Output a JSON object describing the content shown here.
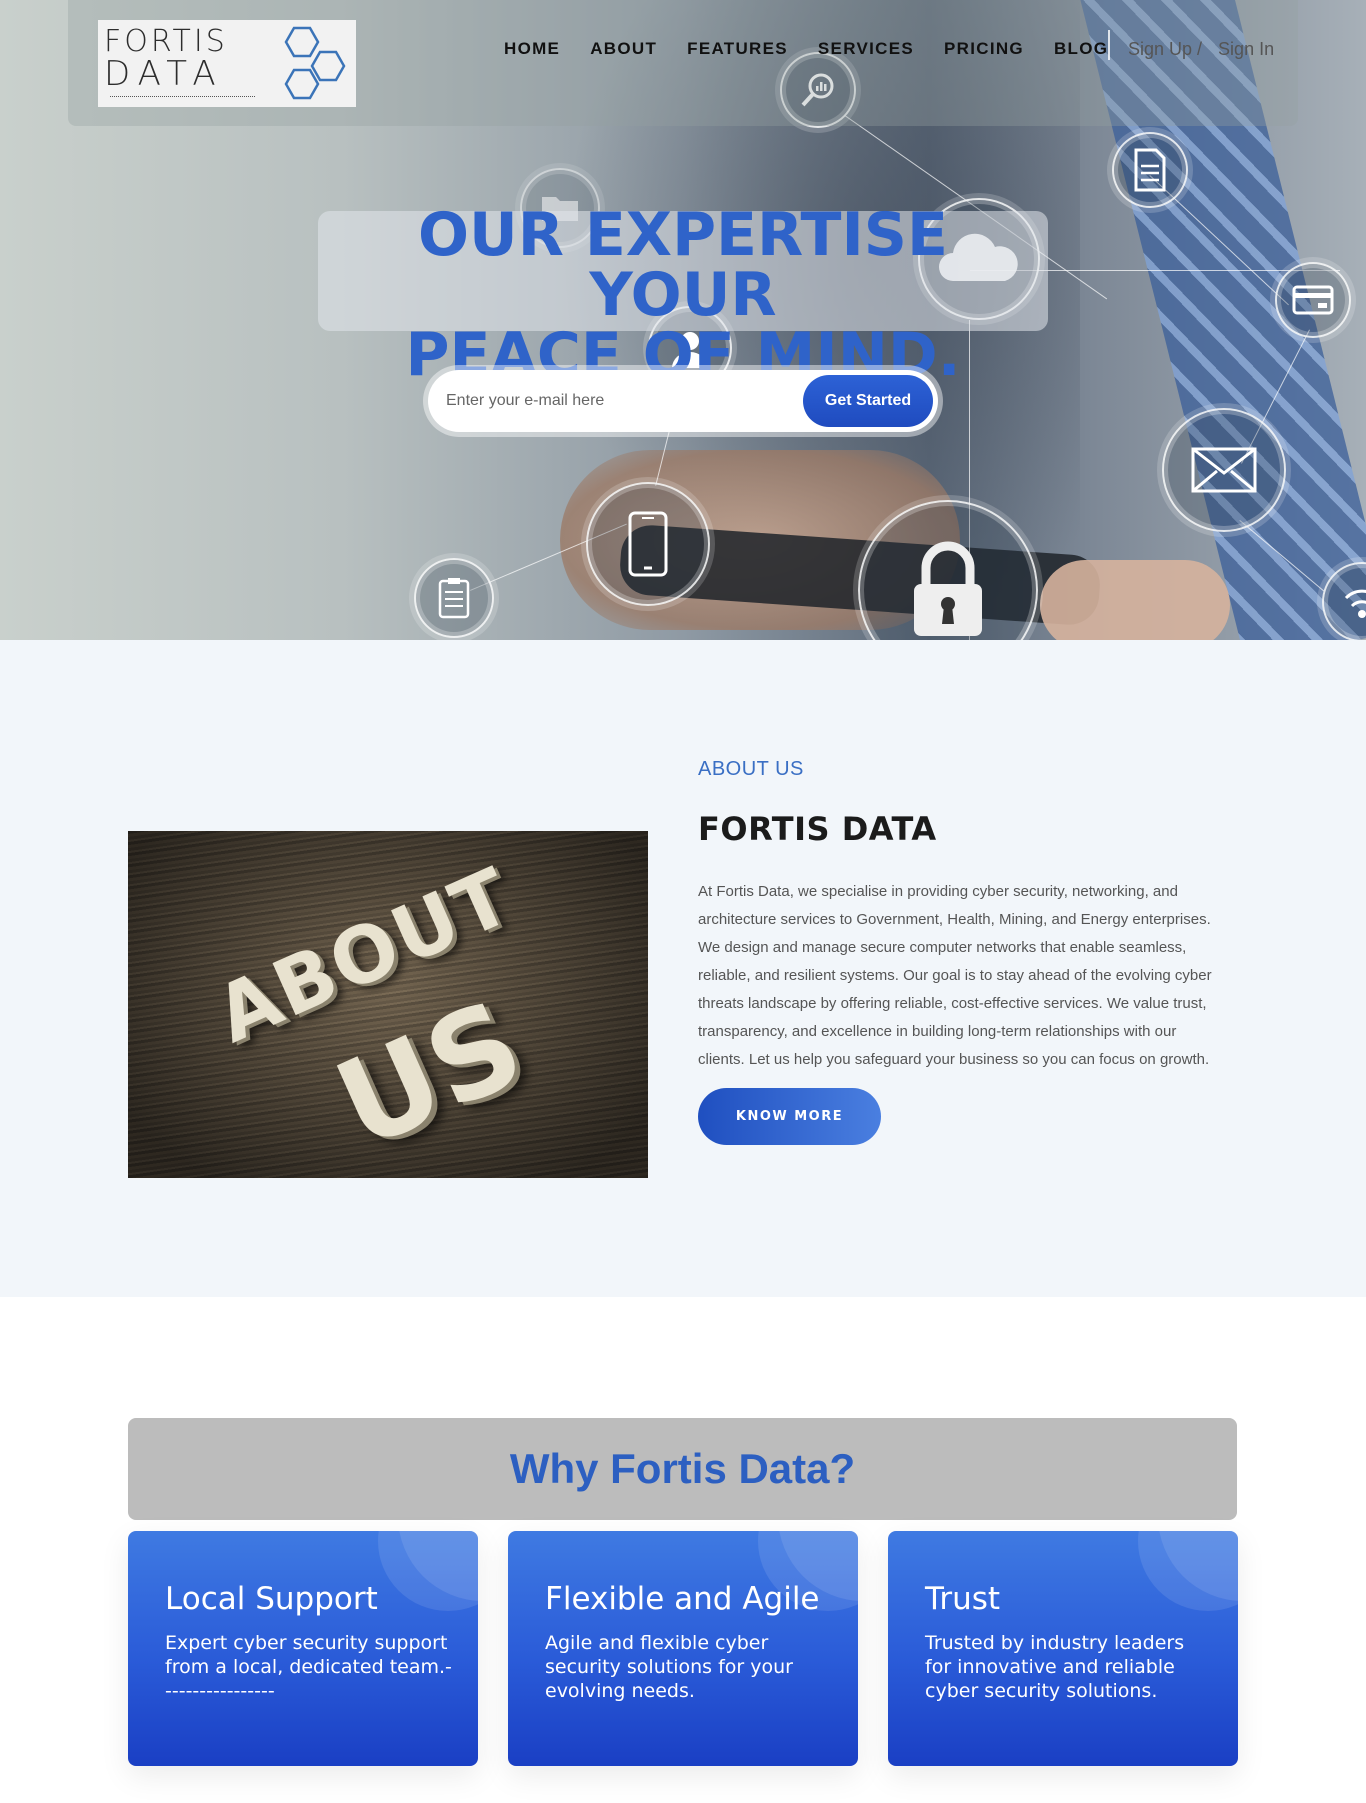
{
  "nav": {
    "logo": {
      "line1": "FORTIS",
      "line2": "DATA"
    },
    "links": [
      "HOME",
      "ABOUT",
      "FEATURES",
      "SERVICES",
      "PRICING",
      "BLOG"
    ],
    "signup": "Sign Up /",
    "signin": "Sign In"
  },
  "hero": {
    "title_line1": "OUR EXPERTISE YOUR",
    "title_line2": "PEACE OF MIND.",
    "email_placeholder": "Enter your e-mail here",
    "cta": "Get Started"
  },
  "about": {
    "image_text_1": "ABOUT",
    "image_text_2": "US",
    "kicker": "ABOUT US",
    "title": "FORTIS DATA",
    "body": "At Fortis Data, we specialise in providing cyber security, networking, and architecture services to Government, Health, Mining, and Energy enterprises. We design and manage secure computer networks that enable seamless, reliable, and resilient systems. Our goal is to stay ahead of the evolving cyber threats landscape by offering reliable, cost-effective services. We value trust, transparency, and excellence in building long-term relationships with our clients. Let us help you safeguard your business so you can focus on growth.",
    "button": "KNOW MORE"
  },
  "why": {
    "heading": "Why Fortis Data?",
    "cards": [
      {
        "title": "Local Support",
        "text": "Expert cyber security support from a local, dedicated team.-----------------"
      },
      {
        "title": "Flexible and Agile",
        "text": "Agile and flexible cyber security solutions for your evolving needs."
      },
      {
        "title": "Trust",
        "text": "Trusted by industry leaders for innovative and reliable cyber security solutions."
      }
    ]
  },
  "colors": {
    "accent": "#2f63c9",
    "card_gradient_top": "#3f7ae2",
    "card_gradient_bottom": "#1a3fc4",
    "about_bg": "#f2f6fa"
  },
  "icons": [
    "search-chart-icon",
    "document-icon",
    "cloud-icon",
    "credit-card-icon",
    "user-icon",
    "mail-icon",
    "mobile-phone-icon",
    "clipboard-icon",
    "padlock-icon",
    "wifi-icon",
    "folder-icon"
  ]
}
